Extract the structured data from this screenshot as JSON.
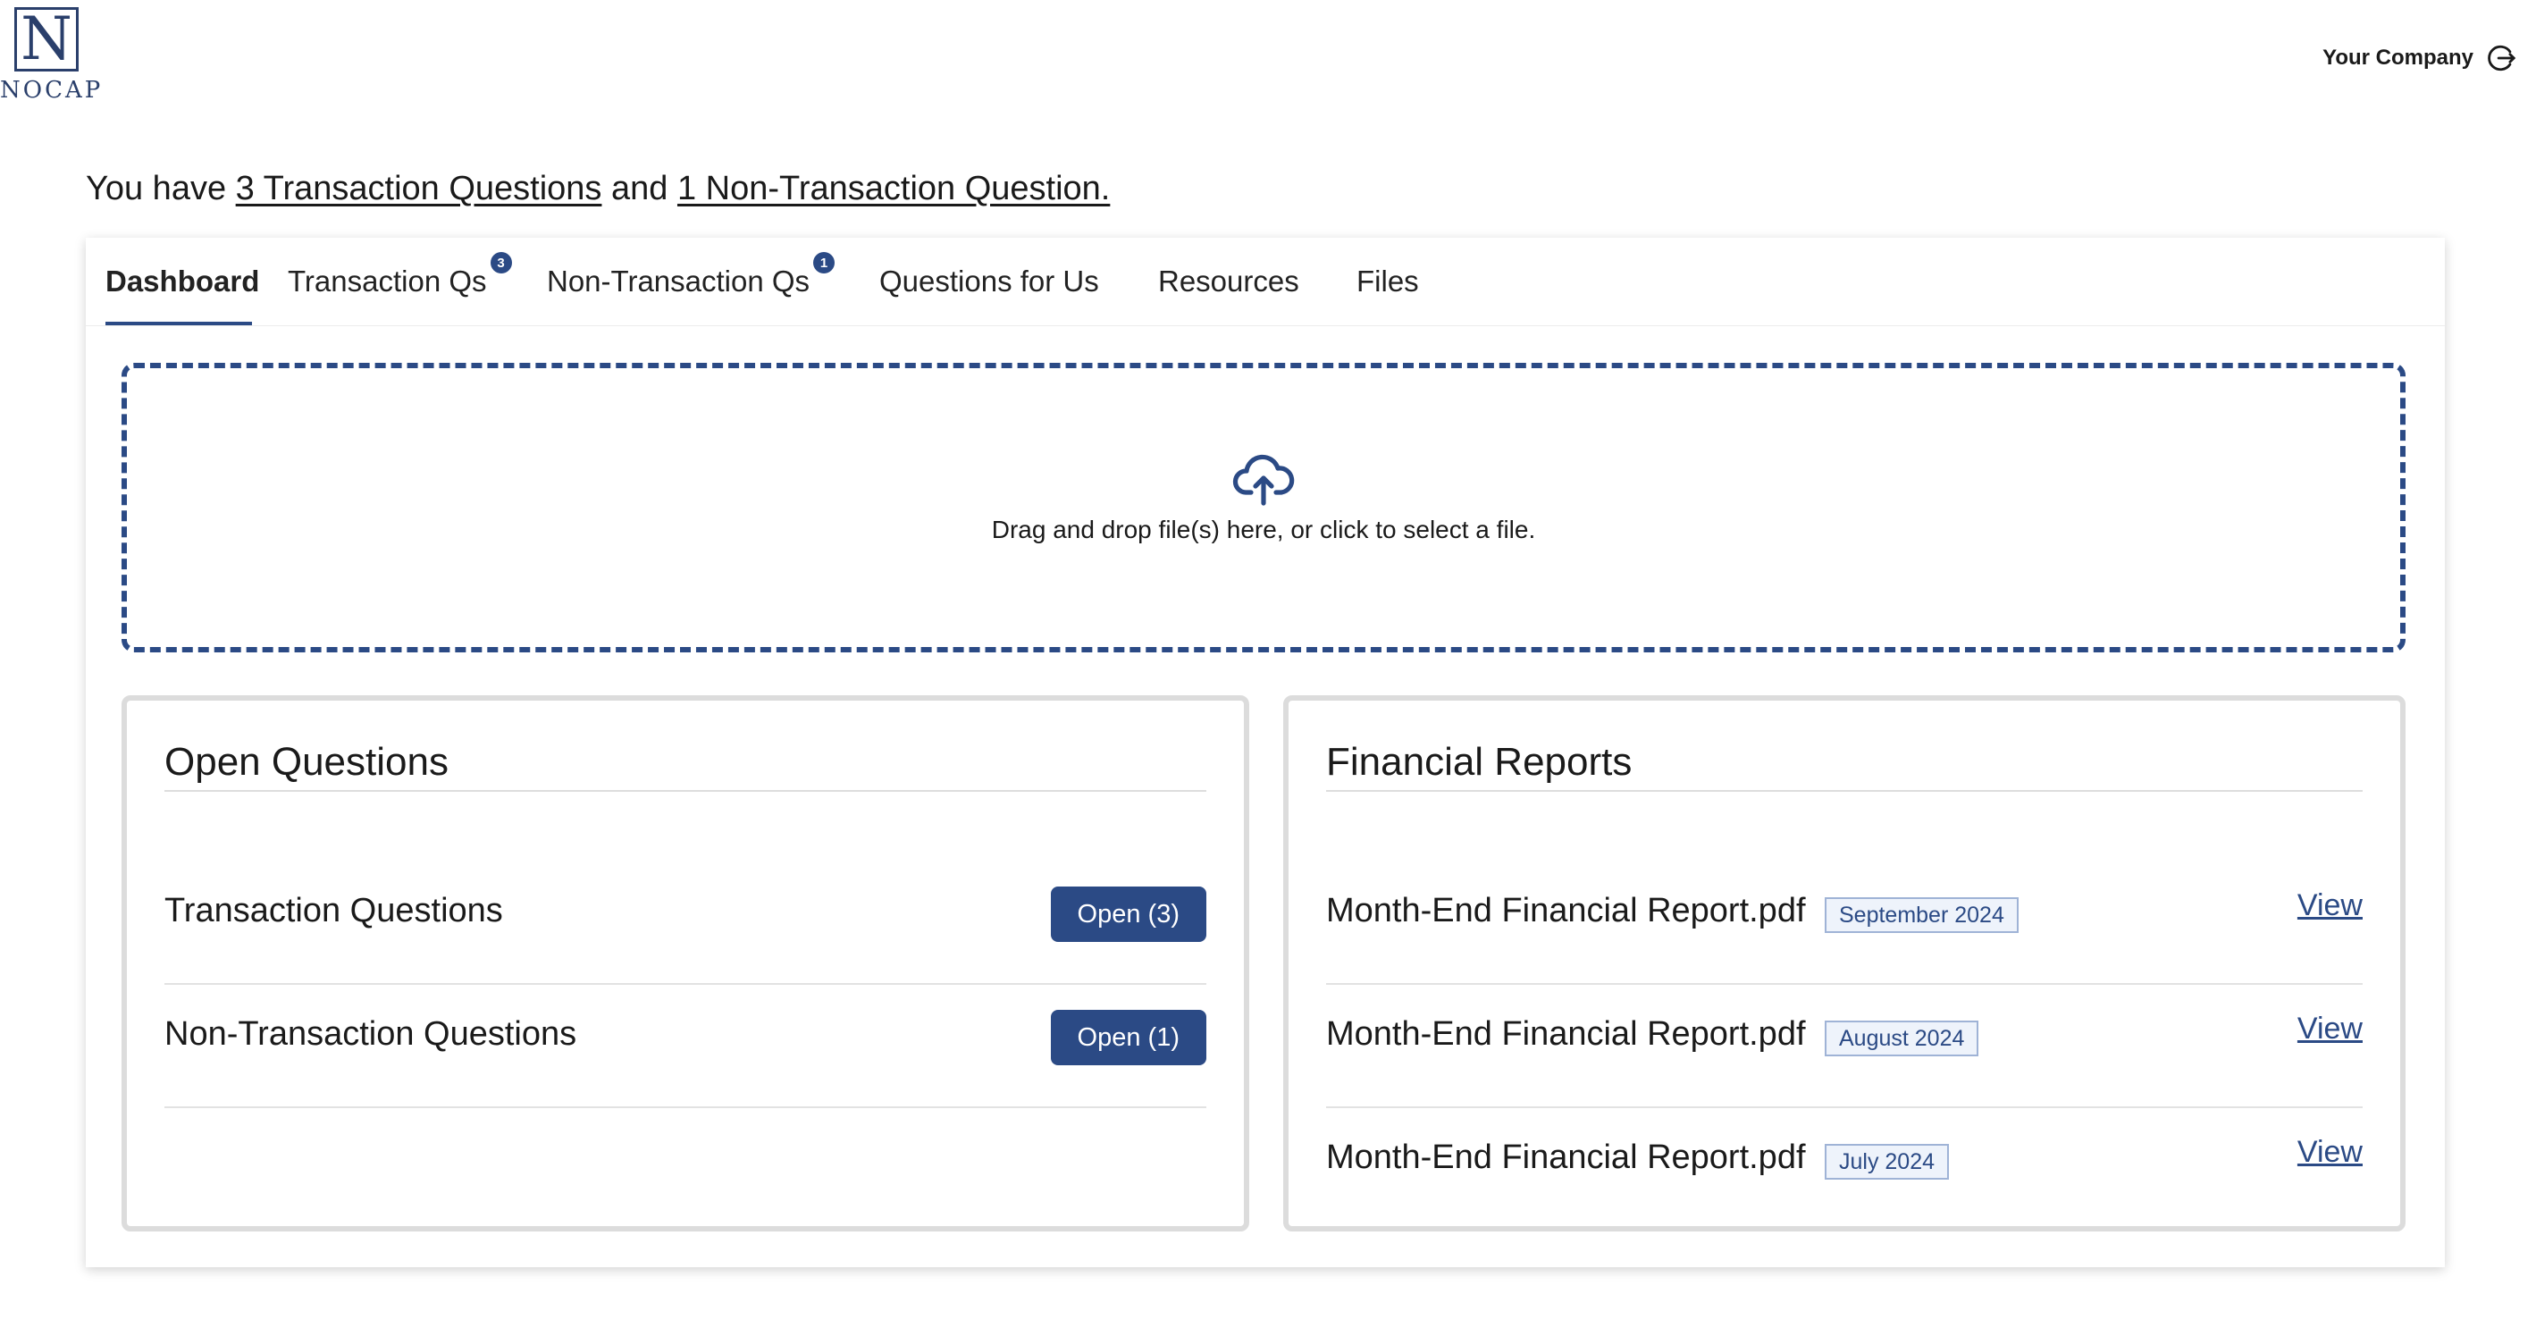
{
  "logo": {
    "letter": "N",
    "text": "NOCAP"
  },
  "header": {
    "company": "Your Company",
    "logout_icon": "logout-icon"
  },
  "summary": {
    "prefix": "You have",
    "transaction_link": "3 Transaction Questions",
    "middle": "and",
    "non_transaction_link": "1 Non-Transaction Question."
  },
  "tabs": [
    {
      "label": "Dashboard",
      "active": true
    },
    {
      "label": "Transaction Qs",
      "badge": "3"
    },
    {
      "label": "Non-Transaction Qs",
      "badge": "1"
    },
    {
      "label": "Questions for Us"
    },
    {
      "label": "Resources"
    },
    {
      "label": "Files"
    }
  ],
  "dropzone": {
    "icon": "cloud-upload-icon",
    "text": "Drag and drop file(s) here, or click to select a file."
  },
  "open_questions": {
    "title": "Open Questions",
    "rows": [
      {
        "label": "Transaction Questions",
        "button": "Open (3)"
      },
      {
        "label": "Non-Transaction Questions",
        "button": "Open (1)"
      }
    ]
  },
  "financial_reports": {
    "title": "Financial Reports",
    "rows": [
      {
        "file": "Month-End Financial Report.pdf",
        "date": "September 2024",
        "link": "View"
      },
      {
        "file": "Month-End Financial Report.pdf",
        "date": "August 2024",
        "link": "View"
      },
      {
        "file": "Month-End Financial Report.pdf",
        "date": "July 2024",
        "link": "View"
      }
    ]
  },
  "colors": {
    "primary": "#2b4a85",
    "logo": "#2a3f6b",
    "tag_bg": "#eef3fb",
    "tag_border": "#9fb3d6"
  }
}
